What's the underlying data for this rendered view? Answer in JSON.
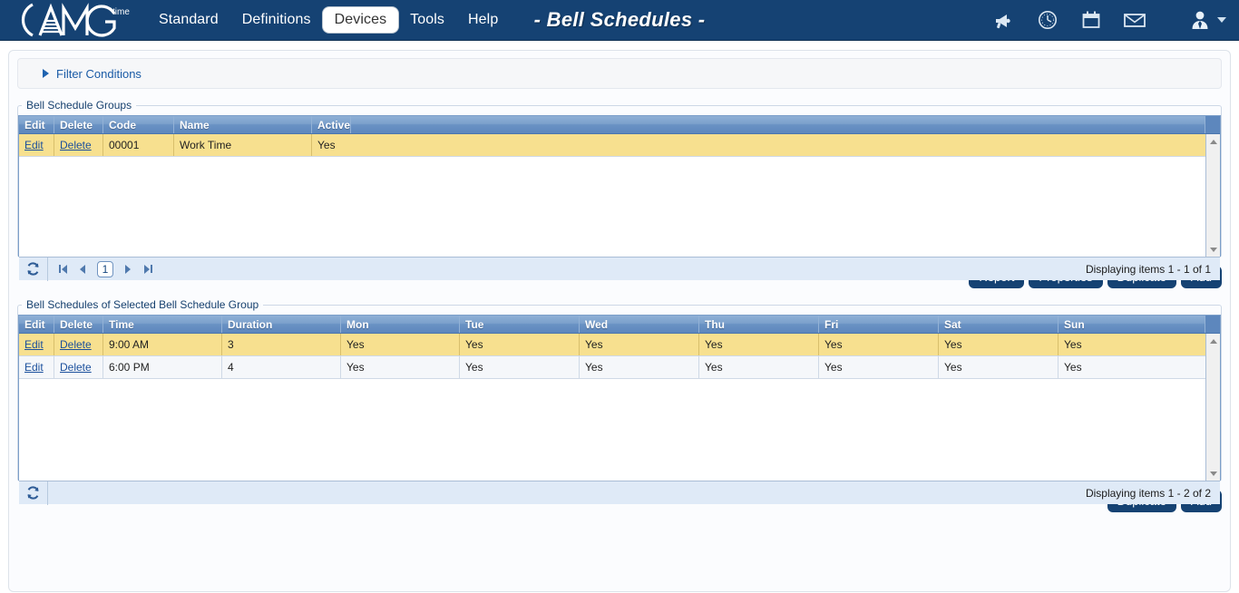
{
  "navbar": {
    "logo_text": "AMG",
    "logo_superscript": "time",
    "menu": [
      {
        "label": "Standard",
        "active": false
      },
      {
        "label": "Definitions",
        "active": false
      },
      {
        "label": "Devices",
        "active": true
      },
      {
        "label": "Tools",
        "active": false
      },
      {
        "label": "Help",
        "active": false
      }
    ],
    "title": "- Bell Schedules -",
    "icons": [
      "megaphone-icon",
      "clock-icon",
      "calendar-icon",
      "envelope-icon"
    ],
    "user_icon": "user-avatar-icon"
  },
  "filter": {
    "label": "Filter Conditions",
    "expanded": false
  },
  "groups_grid": {
    "legend": "Bell Schedule Groups",
    "columns": [
      "Edit",
      "Delete",
      "Code",
      "Name",
      "Active",
      ""
    ],
    "rows": [
      {
        "edit": "Edit",
        "delete": "Delete",
        "code": "00001",
        "name": "Work Time",
        "active": "Yes",
        "selected": true
      }
    ],
    "footer": {
      "refresh_icon": "refresh-icon",
      "page_number": "1",
      "info": "Displaying items 1 - 1 of 1"
    },
    "buttons": [
      {
        "label": "Report"
      },
      {
        "label": "Properties"
      },
      {
        "label": "Duplicate"
      },
      {
        "label": "Add"
      }
    ]
  },
  "schedules_grid": {
    "legend": "Bell Schedules of Selected Bell Schedule Group",
    "columns": [
      "Edit",
      "Delete",
      "Time",
      "Duration",
      "Mon",
      "Tue",
      "Wed",
      "Thu",
      "Fri",
      "Sat",
      "Sun",
      ""
    ],
    "rows": [
      {
        "edit": "Edit",
        "delete": "Delete",
        "time": "9:00 AM",
        "duration": "3",
        "mon": "Yes",
        "tue": "Yes",
        "wed": "Yes",
        "thu": "Yes",
        "fri": "Yes",
        "sat": "Yes",
        "sun": "Yes",
        "selected": true
      },
      {
        "edit": "Edit",
        "delete": "Delete",
        "time": "6:00 PM",
        "duration": "4",
        "mon": "Yes",
        "tue": "Yes",
        "wed": "Yes",
        "thu": "Yes",
        "fri": "Yes",
        "sat": "Yes",
        "sun": "Yes",
        "selected": false
      }
    ],
    "footer": {
      "refresh_icon": "refresh-icon",
      "info": "Displaying items 1 - 2 of 2"
    },
    "buttons": [
      {
        "label": "Duplicate"
      },
      {
        "label": "Add"
      }
    ]
  },
  "colors": {
    "navbar_bg": "#154273",
    "button_bg": "#154273",
    "header_blue": "#6a92c4",
    "selected_row": "#f7e08f",
    "link": "#1a4f9c",
    "footer_bg": "#dfeaf7"
  }
}
